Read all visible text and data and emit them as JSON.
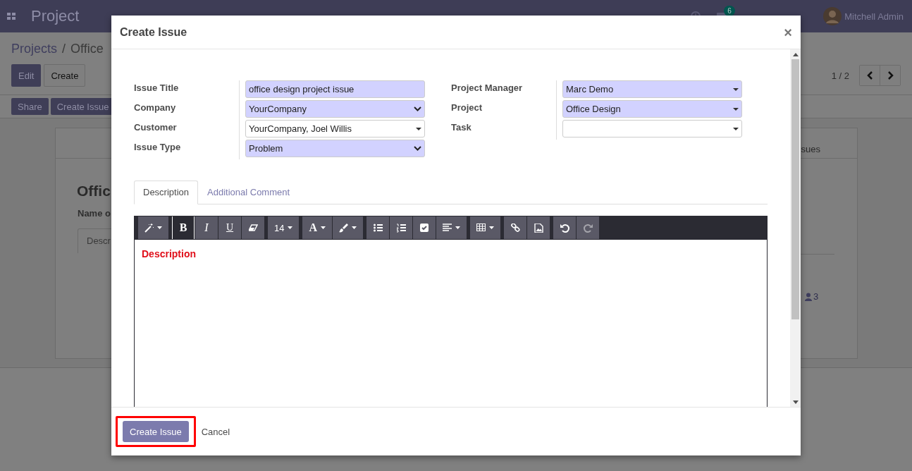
{
  "navbar": {
    "app_name": "Project",
    "message_count": "6",
    "user": "Mitchell Admin"
  },
  "breadcrumb": {
    "separator": "/",
    "items": [
      {
        "label": "Projects",
        "kind": "link"
      },
      {
        "label": "Office",
        "kind": "current"
      }
    ]
  },
  "actions": [
    {
      "label": "Edit",
      "kind": "primary"
    },
    {
      "label": "Create",
      "kind": "secondary"
    }
  ],
  "pager": "1 / 2",
  "status_buttons": [
    "Share",
    "Create Issue"
  ],
  "record": {
    "title": "Offic",
    "field_label": "Name o",
    "tab": "Descr",
    "smart_button": "sues",
    "follower_count": "3"
  },
  "dialog": {
    "title": "Create Issue",
    "close": "×",
    "fields_left": [
      {
        "label": "Issue Title",
        "value": "office design project issue",
        "kind": "text",
        "required": true
      },
      {
        "label": "Company",
        "value": "YourCompany",
        "kind": "select",
        "required": true
      },
      {
        "label": "Customer",
        "value": "YourCompany, Joel Willis",
        "kind": "many2one",
        "required": false
      },
      {
        "label": "Issue Type",
        "value": "Problem",
        "kind": "select",
        "required": true
      }
    ],
    "fields_right": [
      {
        "label": "Project Manager",
        "value": "Marc Demo",
        "kind": "many2one",
        "required": true
      },
      {
        "label": "Project",
        "value": "Office Design",
        "kind": "many2one",
        "required": true
      },
      {
        "label": "Task",
        "kind": "many2one",
        "required": false
      }
    ],
    "tabs": [
      {
        "label": "Description",
        "selected": true
      },
      {
        "label": "Additional Comment",
        "selected": false
      }
    ],
    "toolbar": {
      "bold": {
        "label": "B",
        "selected": true
      },
      "italic": {
        "label": "I",
        "selected": false
      },
      "underline": {
        "label": "U",
        "selected": false
      },
      "font_size": "14",
      "font_color": "A",
      "redo": {
        "disabled": true
      }
    },
    "editor_text": "Description",
    "footer_buttons": [
      {
        "label": "Create Issue",
        "kind": "primary",
        "highlighted": true
      },
      {
        "label": "Cancel",
        "kind": "link",
        "highlighted": false
      }
    ]
  }
}
